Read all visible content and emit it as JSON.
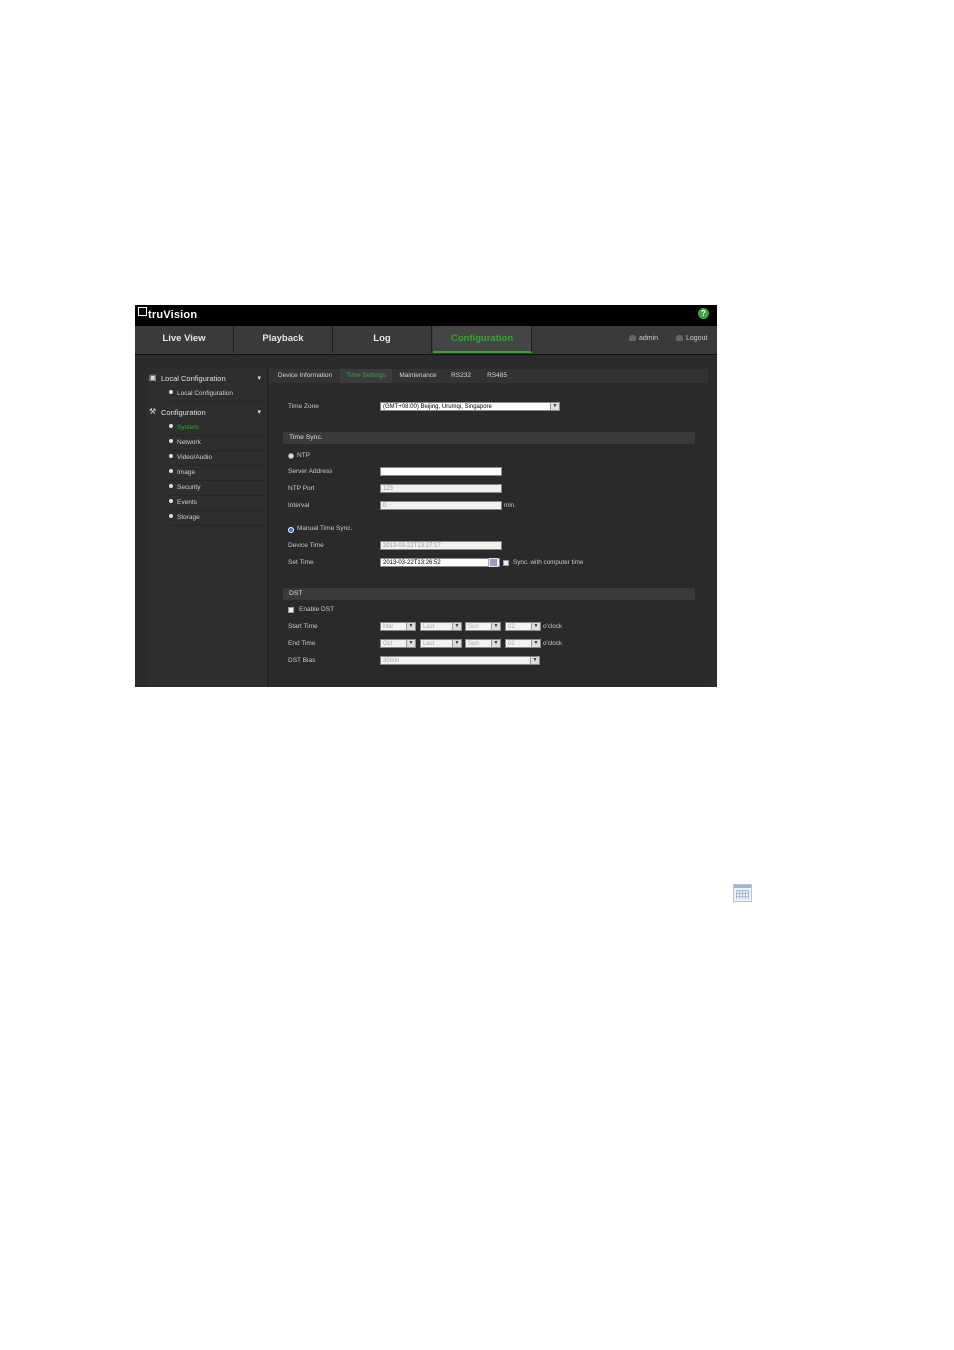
{
  "app": {
    "brand": "truVision"
  },
  "nav": {
    "tabs": [
      "Live View",
      "Playback",
      "Log",
      "Configuration"
    ],
    "active_tab": "Configuration",
    "user": "admin",
    "logout": "Logout"
  },
  "sidebar": {
    "groups": [
      {
        "title": "Local Configuration",
        "items": [
          "Local Configuration"
        ]
      },
      {
        "title": "Configuration",
        "items": [
          "System",
          "Network",
          "Video/Audio",
          "Image",
          "Security",
          "Events",
          "Storage"
        ]
      }
    ],
    "active_item": "System"
  },
  "subtabs": {
    "items": [
      "Device Information",
      "Time Settings",
      "Maintenance",
      "RS232",
      "RS485"
    ],
    "active": "Time Settings"
  },
  "form": {
    "time_zone_label": "Time Zone",
    "time_zone_value": "(GMT+08:00) Beijing, Urumqi, Singapore",
    "time_sync_heading": "Time Sync.",
    "ntp_label": "NTP",
    "server_address_label": "Server Address",
    "server_address_value": "",
    "ntp_port_label": "NTP Port",
    "ntp_port_value": "123",
    "interval_label": "Interval",
    "interval_value": "0",
    "interval_unit": "min.",
    "manual_label": "Manual Time Sync.",
    "device_time_label": "Device Time",
    "device_time_value": "2013-03-22T13:27:17",
    "set_time_label": "Set Time",
    "set_time_value": "2013-03-22T13:26:52",
    "sync_computer_label": "Sync. with computer time",
    "dst_heading": "DST",
    "enable_dst_label": "Enable DST",
    "start_time_label": "Start Time",
    "start_time": {
      "month": "Mar",
      "week": "Last",
      "day": "Sun",
      "hour": "02"
    },
    "end_time_label": "End Time",
    "end_time": {
      "month": "Oct",
      "week": "Last",
      "day": "Sun",
      "hour": "02"
    },
    "oclock": "o'clock",
    "dst_bias_label": "DST Bias",
    "dst_bias_value": "30min"
  },
  "colors": {
    "accent": "#2fa82f",
    "panel": "#2b2b2b",
    "topbar": "#000000"
  },
  "icons": {
    "help": "help-icon",
    "calendar": "calendar-icon"
  }
}
